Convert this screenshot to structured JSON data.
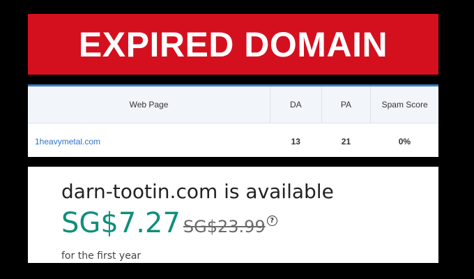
{
  "banner": {
    "title": "EXPIRED DOMAIN",
    "color": "#d4101f"
  },
  "metrics_table": {
    "headers": [
      "Web Page",
      "DA",
      "PA",
      "Spam Score"
    ],
    "rows": [
      {
        "web_page": "1heavymetal.com",
        "da": "13",
        "pa": "21",
        "spam_score": "0%"
      }
    ]
  },
  "availability": {
    "title": "darn-tootin.com is available",
    "price": "SG$7.27",
    "original_price": "SG$23.99",
    "help_icon": "question-circle-icon",
    "help_glyph": "?",
    "note": "for the first year",
    "price_color": "#0f8f7a"
  }
}
